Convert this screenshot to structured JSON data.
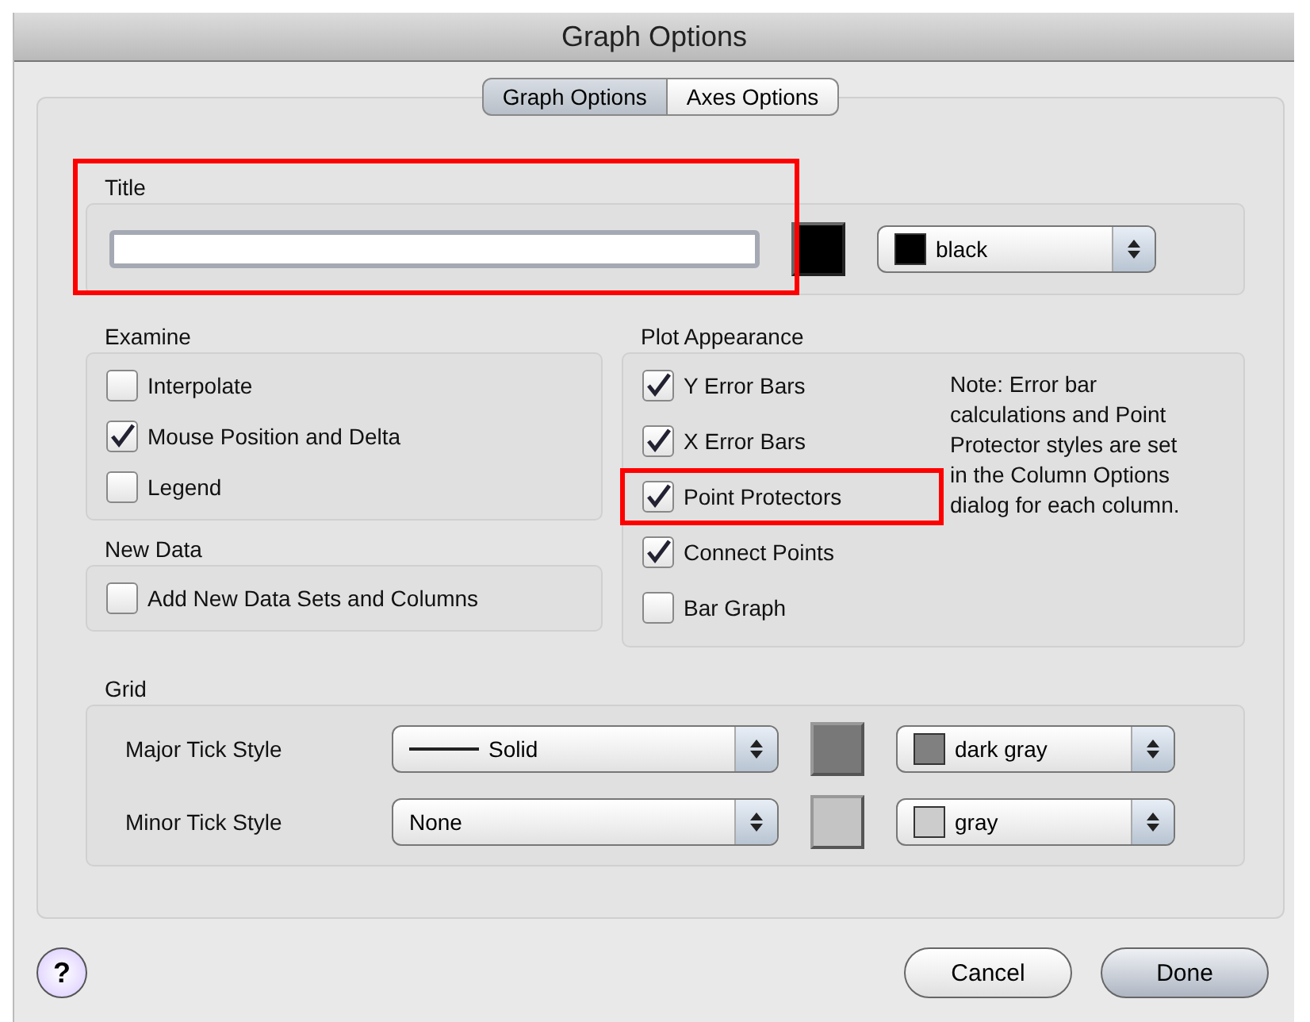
{
  "window": {
    "title": "Graph Options"
  },
  "tabs": [
    {
      "label": "Graph Options",
      "selected": true
    },
    {
      "label": "Axes Options",
      "selected": false
    }
  ],
  "title_group": {
    "label": "Title",
    "highlighted": true,
    "well": {
      "color": "#000000"
    },
    "color_popup": {
      "label": "black",
      "color": "#000000"
    }
  },
  "examine": {
    "label": "Examine",
    "options": [
      {
        "label": "Interpolate",
        "checked": false
      },
      {
        "label": "Mouse Position and Delta",
        "checked": true
      },
      {
        "label": "Legend",
        "checked": false
      }
    ]
  },
  "new_data": {
    "label": "New Data",
    "options": [
      {
        "label": "Add New Data Sets and Columns",
        "checked": false
      }
    ]
  },
  "plot_appearance": {
    "label": "Plot Appearance",
    "options": [
      {
        "label": "Y Error Bars",
        "checked": true,
        "highlighted": false
      },
      {
        "label": "X Error Bars",
        "checked": true,
        "highlighted": false
      },
      {
        "label": "Point Protectors",
        "checked": true,
        "highlighted": true
      },
      {
        "label": "Connect Points",
        "checked": true,
        "highlighted": false
      },
      {
        "label": "Bar Graph",
        "checked": false,
        "highlighted": false
      }
    ],
    "note": "Note: Error bar calculations and Point Protector styles are set in the Column Options dialog for each column."
  },
  "grid": {
    "label": "Grid",
    "rows": [
      {
        "label": "Major Tick Style",
        "style": {
          "label": "Solid",
          "kind": "line"
        },
        "well": {
          "color": "#787878"
        },
        "color_popup": {
          "label": "dark gray",
          "color": "#808080"
        }
      },
      {
        "label": "Minor Tick Style",
        "style": {
          "label": "None",
          "kind": "none"
        },
        "well": {
          "color": "#c4c4c4"
        },
        "color_popup": {
          "label": "gray",
          "color": "#cccccc"
        }
      }
    ]
  },
  "help_button": "?",
  "buttons": [
    {
      "label": "Cancel",
      "default": false
    },
    {
      "label": "Done",
      "default": true
    }
  ]
}
